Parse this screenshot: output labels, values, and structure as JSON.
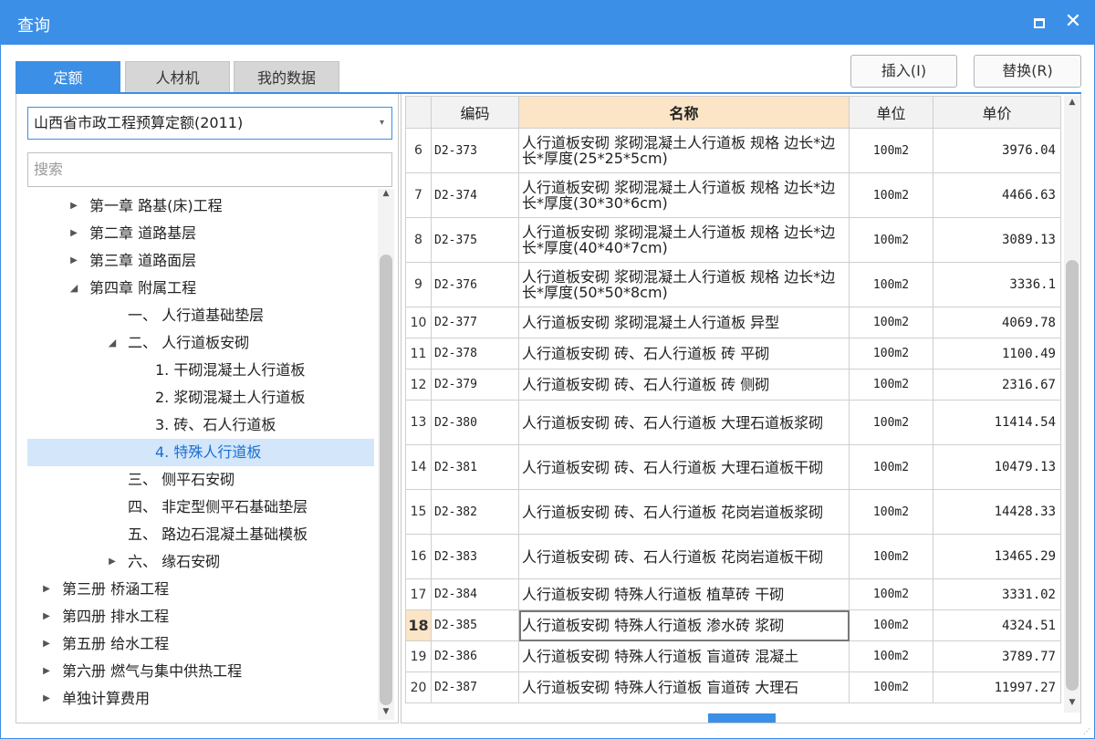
{
  "window": {
    "title": "查询"
  },
  "tabs": [
    "定额",
    "人材机",
    "我的数据"
  ],
  "actions": {
    "insert": "插入(I)",
    "replace": "替换(R)"
  },
  "combo": {
    "value": "山西省市政工程预算定额(2011)"
  },
  "search": {
    "placeholder": "搜索"
  },
  "tree": [
    {
      "label": "第一章 路基(床)工程",
      "indent": 1,
      "toggle": "closed"
    },
    {
      "label": "第二章 道路基层",
      "indent": 1,
      "toggle": "closed"
    },
    {
      "label": "第三章 道路面层",
      "indent": 1,
      "toggle": "closed"
    },
    {
      "label": "第四章 附属工程",
      "indent": 1,
      "toggle": "open"
    },
    {
      "label": "一、 人行道基础垫层",
      "indent": 2,
      "toggle": "none"
    },
    {
      "label": "二、 人行道板安砌",
      "indent": 2,
      "toggle": "open"
    },
    {
      "label": "1. 干砌混凝土人行道板",
      "indent": 3,
      "toggle": "none"
    },
    {
      "label": "2. 浆砌混凝土人行道板",
      "indent": 3,
      "toggle": "none"
    },
    {
      "label": "3. 砖、石人行道板",
      "indent": 3,
      "toggle": "none"
    },
    {
      "label": "4. 特殊人行道板",
      "indent": 3,
      "toggle": "none",
      "selected": true
    },
    {
      "label": "三、 侧平石安砌",
      "indent": 2,
      "toggle": "none"
    },
    {
      "label": "四、 非定型侧平石基础垫层",
      "indent": 2,
      "toggle": "none"
    },
    {
      "label": "五、 路边石混凝土基础模板",
      "indent": 2,
      "toggle": "none"
    },
    {
      "label": "六、 缘石安砌",
      "indent": 2,
      "toggle": "closed"
    },
    {
      "label": "第三册 桥涵工程",
      "indent": 0,
      "toggle": "closed"
    },
    {
      "label": "第四册 排水工程",
      "indent": 0,
      "toggle": "closed"
    },
    {
      "label": "第五册 给水工程",
      "indent": 0,
      "toggle": "closed"
    },
    {
      "label": "第六册 燃气与集中供热工程",
      "indent": 0,
      "toggle": "closed"
    },
    {
      "label": "单独计算费用",
      "indent": 0,
      "toggle": "closed"
    }
  ],
  "grid": {
    "headers": {
      "code": "编码",
      "name": "名称",
      "unit": "单位",
      "price": "单价"
    },
    "current_row": "18",
    "rows": [
      {
        "idx": "6",
        "code": "D2-373",
        "name": "人行道板安砌 浆砌混凝土人行道板 规格 边长*边长*厚度(25*25*5cm)",
        "unit": "100m2",
        "price": "3976.04",
        "tall": true
      },
      {
        "idx": "7",
        "code": "D2-374",
        "name": "人行道板安砌 浆砌混凝土人行道板 规格 边长*边长*厚度(30*30*6cm)",
        "unit": "100m2",
        "price": "4466.63",
        "tall": true
      },
      {
        "idx": "8",
        "code": "D2-375",
        "name": "人行道板安砌 浆砌混凝土人行道板 规格 边长*边长*厚度(40*40*7cm)",
        "unit": "100m2",
        "price": "3089.13",
        "tall": true
      },
      {
        "idx": "9",
        "code": "D2-376",
        "name": "人行道板安砌 浆砌混凝土人行道板 规格 边长*边长*厚度(50*50*8cm)",
        "unit": "100m2",
        "price": "3336.1",
        "tall": true
      },
      {
        "idx": "10",
        "code": "D2-377",
        "name": "人行道板安砌 浆砌混凝土人行道板 异型",
        "unit": "100m2",
        "price": "4069.78",
        "tall": false
      },
      {
        "idx": "11",
        "code": "D2-378",
        "name": "人行道板安砌 砖、石人行道板 砖 平砌",
        "unit": "100m2",
        "price": "1100.49",
        "tall": false
      },
      {
        "idx": "12",
        "code": "D2-379",
        "name": "人行道板安砌 砖、石人行道板 砖 侧砌",
        "unit": "100m2",
        "price": "2316.67",
        "tall": false
      },
      {
        "idx": "13",
        "code": "D2-380",
        "name": "人行道板安砌 砖、石人行道板 大理石道板浆砌",
        "unit": "100m2",
        "price": "11414.54",
        "tall": true
      },
      {
        "idx": "14",
        "code": "D2-381",
        "name": "人行道板安砌 砖、石人行道板 大理石道板干砌",
        "unit": "100m2",
        "price": "10479.13",
        "tall": true
      },
      {
        "idx": "15",
        "code": "D2-382",
        "name": "人行道板安砌 砖、石人行道板 花岗岩道板浆砌",
        "unit": "100m2",
        "price": "14428.33",
        "tall": true
      },
      {
        "idx": "16",
        "code": "D2-383",
        "name": "人行道板安砌 砖、石人行道板 花岗岩道板干砌",
        "unit": "100m2",
        "price": "13465.29",
        "tall": true
      },
      {
        "idx": "17",
        "code": "D2-384",
        "name": "人行道板安砌 特殊人行道板 植草砖 干砌",
        "unit": "100m2",
        "price": "3331.02",
        "tall": false
      },
      {
        "idx": "18",
        "code": "D2-385",
        "name": "人行道板安砌 特殊人行道板 渗水砖 浆砌",
        "unit": "100m2",
        "price": "4324.51",
        "tall": false
      },
      {
        "idx": "19",
        "code": "D2-386",
        "name": "人行道板安砌 特殊人行道板 盲道砖 混凝土",
        "unit": "100m2",
        "price": "3789.77",
        "tall": false
      },
      {
        "idx": "20",
        "code": "D2-387",
        "name": "人行道板安砌 特殊人行道板 盲道砖 大理石",
        "unit": "100m2",
        "price": "11997.27",
        "tall": false
      }
    ]
  },
  "icons": {
    "maximize": "maximize-icon",
    "close": "close-icon",
    "dropdown": "chevron-down-icon",
    "expand": "triangle-right-icon",
    "collapse": "triangle-down-icon"
  },
  "colors": {
    "accent": "#3b8fe6",
    "header_highlight": "#fbe5c6",
    "selection": "#d3e6fa"
  }
}
